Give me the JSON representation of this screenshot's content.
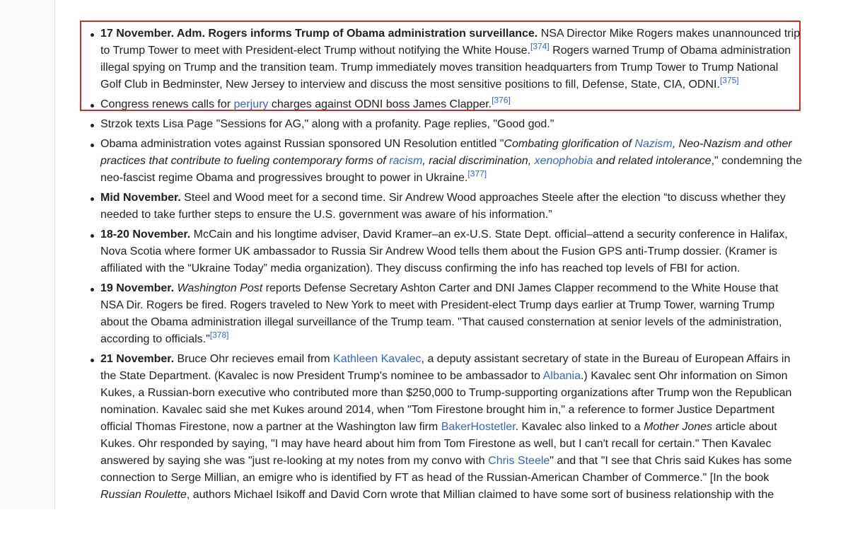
{
  "events": {
    "e1": {
      "date": "17 November.",
      "headline": "Adm. Rogers informs Trump of Obama administration surveillance.",
      "t1": " NSA Director Mike Rogers makes unannounced trip to Trump Tower to meet with President-elect Trump without notifying the White House.",
      "r1": "[374]",
      "t2": " Rogers warned Trump of Obama administration illegal spying on Trump and the transition team. Trump immediately moves transition headquarters from Trump Tower to Trump National Golf Club in Bedminster, New Jersey to interview and discuss the most sensitive positions to fill, Defense, State, CIA, ODNI.",
      "r2": "[375]"
    },
    "e2": {
      "t1": "Congress renews calls for ",
      "link1": "perjury",
      "t2": " charges against ODNI boss James Clapper.",
      "r1": "[376]"
    },
    "e3": {
      "t1": "Strzok texts Lisa Page \"Sessions for AG,\" along with a profanity. Page replies, \"Good god.\""
    },
    "e4": {
      "t1": "Obama administration votes against Russian sponsored UN Resolution entitled \"",
      "i1": "Combating glorification of ",
      "link1": "Nazism",
      "i2": ", Neo-Nazism and other practices that contribute to fueling contemporary forms of ",
      "link2": "racism",
      "i3": ", racial discrimination, ",
      "link3": "xenophobia",
      "i4": " and related intolerance",
      "t2": ",\" condemning the neo-fascist regime Obama and progressives brought to power in Ukraine.",
      "r1": "[377]"
    },
    "e5": {
      "date": "Mid November.",
      "t1": " Steel and Wood meet for a second time. Sir Andrew Wood approaches Steele after the election “to discuss whether they needed to take further steps to ensure the U.S. government was aware of his information.”"
    },
    "e6": {
      "date": "18-20 November.",
      "t1": " McCain and his longtime adviser, David Kramer–an ex-U.S. State Dept. official–attend a security conference in Halifax, Nova Scotia where former UK ambassador to Russia Sir Andrew Wood tells them about the Fusion GPS anti-Trump dossier. (Kramer is affiliated with the “Ukraine Today” media organization). They discuss confirming the info has reached top levels of FBI for action."
    },
    "e7": {
      "date": "19 November.",
      "i1": "Washington Post",
      "t1": " reports Defense Secretary Ashton Carter and DNI James Clapper recommend to the White House that NSA Dir. Rogers be fired. Rogers traveled to New York to meet with President-elect Trump days earlier at Trump Tower, warning Trump about the Obama administration illegal surveillance of the Trump team. \"That caused consternation at senior levels of the administration, according to officials.\"",
      "r1": "[378]"
    },
    "e8": {
      "date": "21 November.",
      "t1": " Bruce Ohr recieves email from ",
      "link1": "Kathleen Kavalec",
      "t2": ", a deputy assistant secretary of state in the Bureau of European Affairs in the State Department. (Kavalec is now President Trump's nominee to be ambassador to ",
      "link2": "Albania",
      "t3": ".) Kavalec sent Ohr information on Simon Kukes, a Russian-born executive who contributed more than $250,000 to Trump-supporting organizations after Trump won the Republican nomination. Kavalec said she met Kukes around 2014, when \"Tom Firestone brought him in,\" a reference to former Justice Department official Thomas Firestone, now a partner at the Washington law firm ",
      "link3": "BakerHostetler",
      "t4": ". Kavalec also linked to a ",
      "i1": "Mother Jones",
      "t5": " article about Kukes. Ohr responded by saying, \"I may have heard about him from Tom Firestone as well, but I can't recall for certain.\" Then Kavalec answered by saying she was \"just re-looking at my notes from my convo with ",
      "link4": "Chris Steele",
      "t6": "\" and that \"I see that Chris said Kukes has some connection to Serge Millian, an emigre who is identified by FT as head of the Russian-American Chamber of Commerce.\" [In the book ",
      "i2": "Russian Roulette",
      "t7": ", authors Michael Isikoff and David Corn wrote that Millian claimed to have some sort of business relationship with the"
    }
  }
}
